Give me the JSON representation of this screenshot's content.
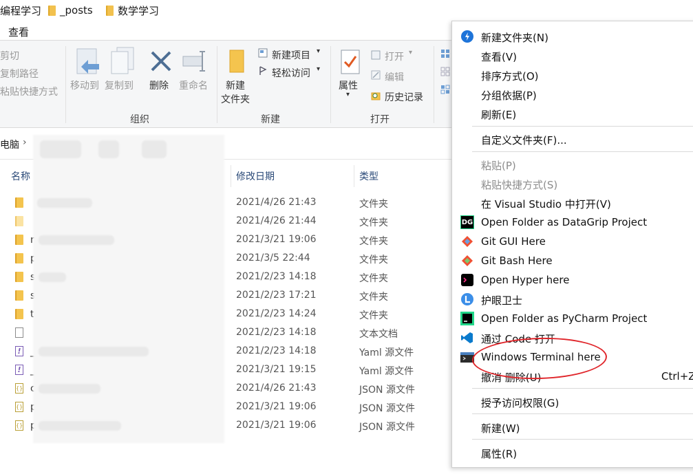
{
  "breadcrumb_top": [
    "编程学习",
    "_posts",
    "数学学习"
  ],
  "ribbon": {
    "tab_view": "查看",
    "clipboard": {
      "cut": "剪切",
      "copy_path": "复制路径",
      "paste_shortcut": "粘贴快捷方式"
    },
    "organize": {
      "move_to": "移动到",
      "copy_to": "复制到",
      "delete": "删除",
      "rename": "重命名",
      "label": "组织"
    },
    "new": {
      "new_folder_l1": "新建",
      "new_folder_l2": "文件夹",
      "new_item": "新建项目",
      "easy_access": "轻松访问",
      "label": "新建"
    },
    "open": {
      "properties": "属性",
      "open": "打开",
      "edit": "编辑",
      "history": "历史记录",
      "label": "打开"
    }
  },
  "address": {
    "root": "电脑"
  },
  "columns": {
    "name": "名称",
    "modified": "修改日期",
    "type": "类型"
  },
  "files": [
    {
      "icon": "folder",
      "letter": "",
      "date": "2021/4/26 21:43",
      "type": "文件夹"
    },
    {
      "icon": "folder-light",
      "letter": "",
      "date": "2021/4/26 21:44",
      "type": "文件夹"
    },
    {
      "icon": "folder",
      "letter": "n",
      "date": "2021/3/21 19:06",
      "type": "文件夹"
    },
    {
      "icon": "folder",
      "letter": "p",
      "date": "2021/3/5 22:44",
      "type": "文件夹"
    },
    {
      "icon": "folder",
      "letter": "s",
      "date": "2021/2/23 14:18",
      "type": "文件夹"
    },
    {
      "icon": "folder",
      "letter": "s",
      "date": "2021/2/23 17:21",
      "type": "文件夹"
    },
    {
      "icon": "folder",
      "letter": "t",
      "date": "2021/2/23 14:24",
      "type": "文件夹"
    },
    {
      "icon": "doc",
      "letter": "",
      "date": "2021/2/23 14:18",
      "type": "文本文档"
    },
    {
      "icon": "yaml",
      "letter": "_",
      "date": "2021/2/23 14:18",
      "type": "Yaml 源文件"
    },
    {
      "icon": "yaml",
      "letter": "_",
      "date": "2021/3/21 19:15",
      "type": "Yaml 源文件"
    },
    {
      "icon": "json",
      "letter": "c",
      "date": "2021/4/26 21:43",
      "type": "JSON 源文件"
    },
    {
      "icon": "json",
      "letter": "p",
      "date": "2021/3/21 19:06",
      "type": "JSON 源文件"
    },
    {
      "icon": "json",
      "letter": "p",
      "date": "2021/3/21 19:06",
      "type": "JSON 源文件"
    }
  ],
  "context_menu": {
    "new_folder": "新建文件夹(N)",
    "view": "查看(V)",
    "sort_by": "排序方式(O)",
    "group_by": "分组依据(P)",
    "refresh": "刷新(E)",
    "customize": "自定义文件夹(F)...",
    "paste": "粘贴(P)",
    "paste_shortcut": "粘贴快捷方式(S)",
    "open_vs": "在 Visual Studio 中打开(V)",
    "datagrip": "Open Folder as DataGrip Project",
    "git_gui": "Git GUI Here",
    "git_bash": "Git Bash Here",
    "hyper": "Open Hyper here",
    "eye_guard": "护眼卫士",
    "pycharm": "Open Folder as PyCharm Project",
    "vscode": "通过 Code 打开",
    "windows_terminal": "Windows Terminal here",
    "undo_delete": "撤消 删除(U)",
    "undo_shortcut": "Ctrl+Z",
    "grant_access": "授予访问权限(G)",
    "new": "新建(W)",
    "properties": "属性(R)",
    "dg_badge": "DG"
  },
  "colors": {
    "menu_annotation": "#e0262b",
    "folder": "#f4c44e"
  }
}
